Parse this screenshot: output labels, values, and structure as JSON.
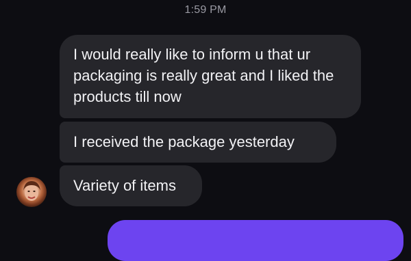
{
  "header": {
    "timestamp": "1:59 PM"
  },
  "messages": [
    {
      "direction": "incoming",
      "text": "I would really like to inform u that ur packaging is really great and I liked the products till now"
    },
    {
      "direction": "incoming",
      "text": "I received the package yesterday"
    },
    {
      "direction": "incoming",
      "text": "Variety of items"
    }
  ],
  "contact": {
    "avatar_icon": "user-photo"
  },
  "colors": {
    "background": "#0d0d12",
    "incoming_bubble": "#26262b",
    "outgoing_bubble": "#6d44f0",
    "timestamp": "#9a9aa3"
  }
}
